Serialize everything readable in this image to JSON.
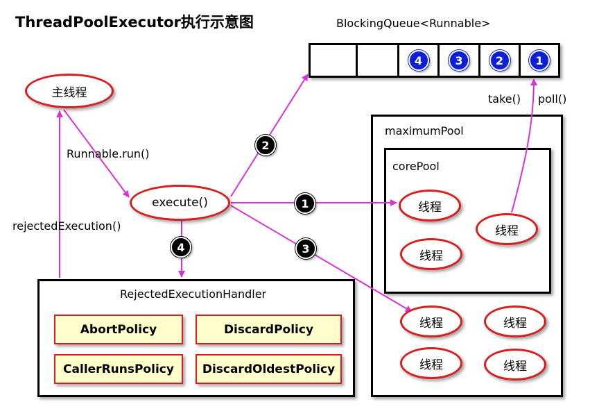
{
  "title": "ThreadPoolExecutor执行示意图",
  "queue": {
    "label": "BlockingQueue<Runnable>",
    "items": [
      "4",
      "3",
      "2",
      "1"
    ]
  },
  "main_thread": "主线程",
  "execute": "execute()",
  "labels": {
    "runnable_run": "Runnable.run()",
    "rejected_execution": "rejectedExecution()",
    "take": "take()",
    "poll": "poll()"
  },
  "maximum_pool": {
    "label": "maximumPool"
  },
  "core_pool": {
    "label": "corePool"
  },
  "thread_label": "线程",
  "handler": {
    "label": "RejectedExecutionHandler",
    "policies": [
      "AbortPolicy",
      "DiscardPolicy",
      "CallerRunsPolicy",
      "DiscardOldestPolicy"
    ]
  },
  "steps": [
    "1",
    "2",
    "3",
    "4"
  ],
  "colors": {
    "arrow": "#d633d6",
    "ellipse_border": "#d81e1e",
    "policy_fill": "#ffffcc",
    "queue_badge": "#0a1fd6"
  }
}
